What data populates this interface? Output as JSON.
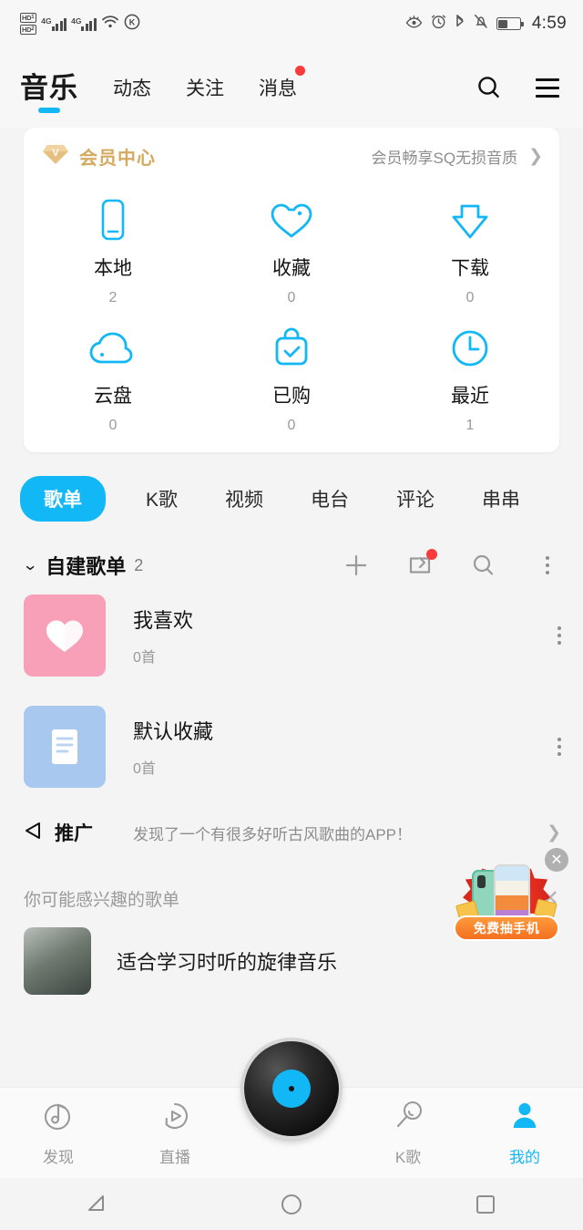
{
  "status_bar": {
    "hd1_label": "HD",
    "hd1_sub": "1",
    "hd2_label": "HD",
    "hd2_sub": "2",
    "net1": "4G",
    "net2": "4G",
    "wifi_icon": "wifi-icon",
    "k_icon": "k-circle-icon",
    "eye_icon": "eye-care-icon",
    "alarm_icon": "alarm-icon",
    "bluetooth_icon": "bluetooth-icon",
    "mute_icon": "bell-muted-icon",
    "battery_icon": "battery-icon",
    "time": "4:59"
  },
  "header": {
    "brand": "音乐",
    "tabs": [
      {
        "label": "动态",
        "badge": false
      },
      {
        "label": "关注",
        "badge": false
      },
      {
        "label": "消息",
        "badge": true
      }
    ],
    "search_icon": "search-icon",
    "menu_icon": "hamburger-menu-icon"
  },
  "vip_banner": {
    "icon": "vip-diamond-icon",
    "title": "会员中心",
    "subtitle": "会员畅享SQ无损音质",
    "chevron": "chevron-right-icon",
    "accent_color": "#d4aa5f"
  },
  "quick_grid": [
    {
      "label": "本地",
      "count": "2",
      "icon": "phone-icon"
    },
    {
      "label": "收藏",
      "count": "0",
      "icon": "heart-outline-icon"
    },
    {
      "label": "下载",
      "count": "0",
      "icon": "download-arrow-icon"
    },
    {
      "label": "云盘",
      "count": "0",
      "icon": "cloud-icon"
    },
    {
      "label": "已购",
      "count": "0",
      "icon": "bag-check-icon"
    },
    {
      "label": "最近",
      "count": "1",
      "icon": "clock-icon"
    }
  ],
  "category_tabs": [
    {
      "label": "歌单",
      "active": true
    },
    {
      "label": "K歌",
      "active": false
    },
    {
      "label": "视频",
      "active": false
    },
    {
      "label": "电台",
      "active": false
    },
    {
      "label": "评论",
      "active": false
    },
    {
      "label": "串串",
      "active": false
    }
  ],
  "section": {
    "chevron": "chevron-down-icon",
    "title": "自建歌单",
    "count": "2",
    "add_icon": "plus-icon",
    "import_icon": "import-playlist-icon",
    "import_badge": true,
    "search_icon": "search-icon",
    "more_icon": "more-vertical-icon"
  },
  "playlists": [
    {
      "name": "我喜欢",
      "sub": "0首",
      "thumb_icon": "heart-icon",
      "thumb_color": "#f7a0b8",
      "more_icon": "more-vertical-icon"
    },
    {
      "name": "默认收藏",
      "sub": "0首",
      "thumb_icon": "list-document-icon",
      "thumb_color": "#a8c8ef",
      "more_icon": "more-vertical-icon"
    }
  ],
  "promo": {
    "icon": "megaphone-icon",
    "label": "推广",
    "text": "发现了一个有很多好听古风歌曲的APP！",
    "chevron": "chevron-right-icon"
  },
  "suggest": {
    "title": "你可能感兴趣的歌单",
    "close_icon": "close-icon",
    "item_title": "适合学习时听的旋律音乐"
  },
  "ad": {
    "close_icon": "close-circle-icon",
    "pill_label": "免费抽手机"
  },
  "bottom_nav": [
    {
      "label": "发现",
      "icon": "music-note-disc-icon",
      "active": false
    },
    {
      "label": "直播",
      "icon": "live-play-icon",
      "active": false
    },
    {
      "label": "K歌",
      "icon": "microphone-icon",
      "active": false
    },
    {
      "label": "我的",
      "icon": "user-icon",
      "active": true
    }
  ],
  "center_button": {
    "icon": "vinyl-record-icon",
    "accent": "#12b7f5"
  },
  "system_nav": {
    "back_icon": "back-triangle-icon",
    "home_icon": "home-circle-icon",
    "recents_icon": "recents-square-icon"
  },
  "theme": {
    "accent": "#12b7f5",
    "bg": "#f4f4f4",
    "card": "#ffffff"
  }
}
